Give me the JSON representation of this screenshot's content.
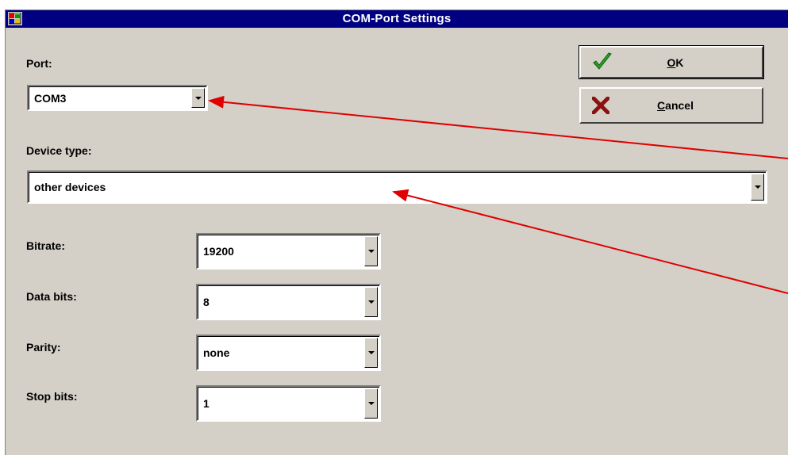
{
  "window": {
    "title": "COM-Port Settings"
  },
  "labels": {
    "port": "Port:",
    "device_type": "Device type:",
    "bitrate": "Bitrate:",
    "data_bits": "Data bits:",
    "parity": "Parity:",
    "stop_bits": "Stop bits:"
  },
  "fields": {
    "port": "COM3",
    "device_type": "other devices",
    "bitrate": "19200",
    "data_bits": "8",
    "parity": "none",
    "stop_bits": "1"
  },
  "buttons": {
    "ok": {
      "mnemonic": "O",
      "rest": "K",
      "icon": "checkmark-icon"
    },
    "cancel": {
      "mnemonic": "C",
      "rest": "ancel",
      "icon": "x-icon"
    }
  },
  "colors": {
    "title_bar": "#000080",
    "window_bg": "#d4d0c8",
    "annotation_arrow": "#e00000",
    "ok_check": "#2aa02a",
    "cancel_x": "#8b1010"
  }
}
